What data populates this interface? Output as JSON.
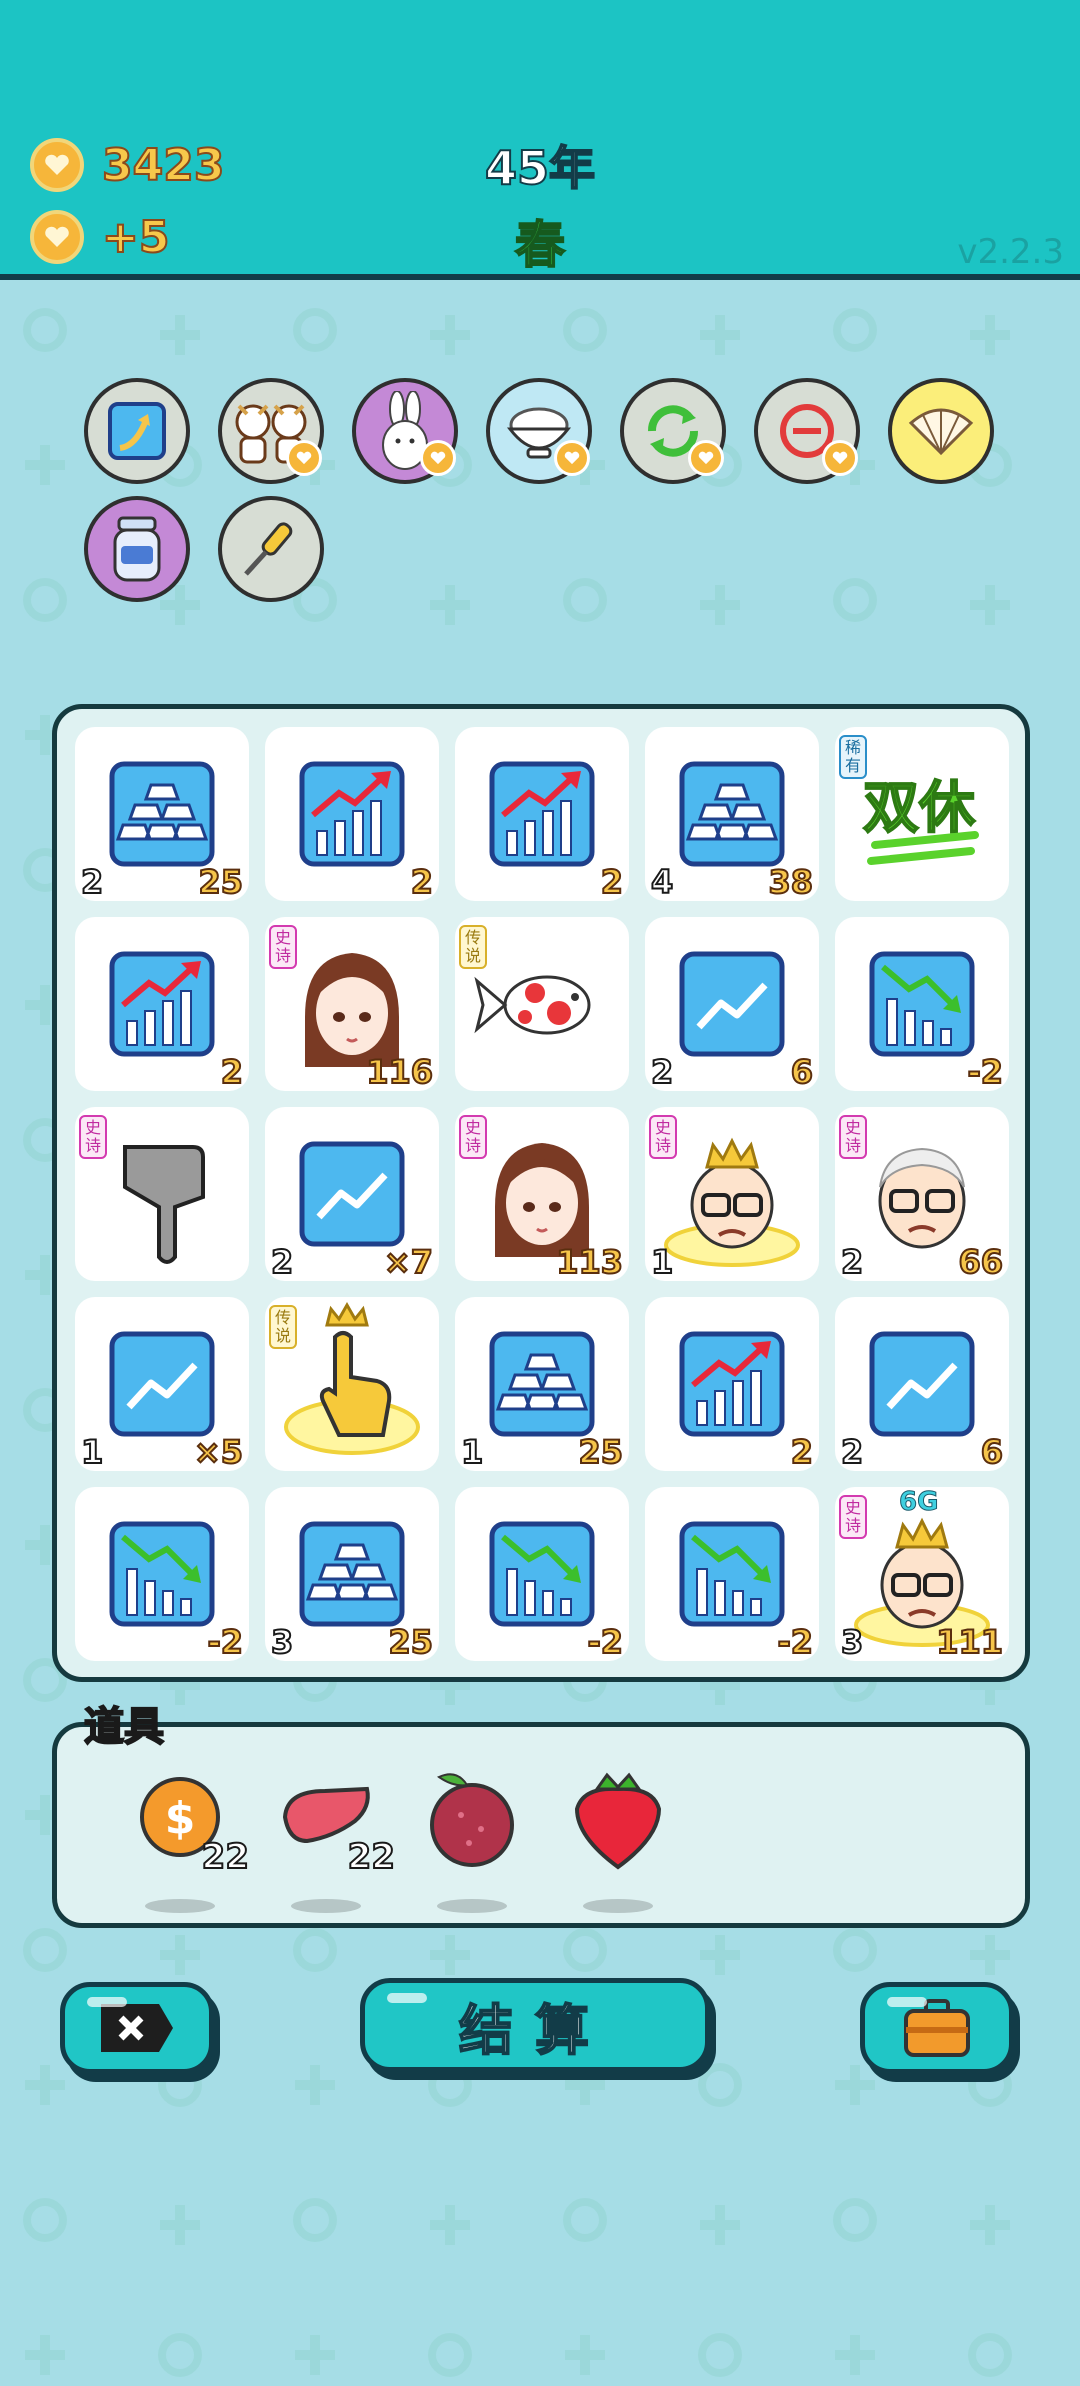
{
  "header": {
    "coins": "3423",
    "income": "+5",
    "year": "45年",
    "season": "春",
    "version": "v2.2.3",
    "coin_icon": "coin-heart-icon"
  },
  "top_icons": [
    {
      "name": "arrow-upgrade-icon",
      "bg": "#d7ddd4"
    },
    {
      "name": "cow-girls-icon",
      "bg": "#d7ddd4"
    },
    {
      "name": "rabbit-icon",
      "bg": "#c489d6"
    },
    {
      "name": "rice-bowl-icon",
      "bg": "#bfe8f4"
    },
    {
      "name": "refresh-icon",
      "bg": "#d7ddd4"
    },
    {
      "name": "minus-remove-icon",
      "bg": "#d7ddd4"
    },
    {
      "name": "shell-icon",
      "bg": "#fbee7a"
    },
    {
      "name": "jar-icon",
      "bg": "#c489d6"
    },
    {
      "name": "screwdriver-icon",
      "bg": "#d7ddd4"
    }
  ],
  "board": {
    "rows": [
      [
        {
          "icon": "gold-bars-icon",
          "left": "2",
          "right": "25",
          "tag": ""
        },
        {
          "icon": "chart-up-icon",
          "left": "",
          "right": "2",
          "tag": ""
        },
        {
          "icon": "chart-up-icon",
          "left": "",
          "right": "2",
          "tag": ""
        },
        {
          "icon": "gold-bars-icon",
          "left": "4",
          "right": "38",
          "tag": ""
        },
        {
          "icon": "double-rest-text-icon",
          "left": "",
          "right": "",
          "tag": "稀有",
          "text": "双休"
        }
      ],
      [
        {
          "icon": "chart-up-icon",
          "left": "",
          "right": "2",
          "tag": ""
        },
        {
          "icon": "girl-portrait-icon",
          "left": "",
          "right": "116",
          "tag": "史诗"
        },
        {
          "icon": "koi-fish-icon",
          "left": "",
          "right": "",
          "tag": "传说"
        },
        {
          "icon": "trend-line-icon",
          "left": "2",
          "right": "6",
          "tag": ""
        },
        {
          "icon": "chart-down-icon",
          "left": "",
          "right": "-2",
          "tag": ""
        }
      ],
      [
        {
          "icon": "pointing-hand-icon",
          "left": "",
          "right": "",
          "tag": "史诗"
        },
        {
          "icon": "trend-line-icon",
          "left": "2",
          "right": "×7",
          "tag": ""
        },
        {
          "icon": "girl-portrait-icon",
          "left": "",
          "right": "113",
          "tag": "史诗"
        },
        {
          "icon": "crowned-old-man-icon",
          "left": "1",
          "right": "",
          "tag": "史诗"
        },
        {
          "icon": "old-man-icon",
          "left": "2",
          "right": "66",
          "tag": "史诗"
        }
      ],
      [
        {
          "icon": "trend-line-icon",
          "left": "1",
          "right": "×5",
          "tag": ""
        },
        {
          "icon": "golden-hand-icon",
          "left": "",
          "right": "",
          "tag": "传说"
        },
        {
          "icon": "gold-bars-icon",
          "left": "1",
          "right": "25",
          "tag": ""
        },
        {
          "icon": "chart-up-icon",
          "left": "",
          "right": "2",
          "tag": ""
        },
        {
          "icon": "trend-line-icon",
          "left": "2",
          "right": "6",
          "tag": ""
        }
      ],
      [
        {
          "icon": "chart-down-icon",
          "left": "",
          "right": "-2",
          "tag": ""
        },
        {
          "icon": "gold-bars-icon",
          "left": "3",
          "right": "25",
          "tag": ""
        },
        {
          "icon": "chart-down-icon",
          "left": "",
          "right": "-2",
          "tag": ""
        },
        {
          "icon": "chart-down-icon",
          "left": "",
          "right": "-2",
          "tag": ""
        },
        {
          "icon": "crowned-old-man-6g-icon",
          "left": "3",
          "right": "111",
          "tag": "史诗",
          "crown_text": "6G"
        }
      ]
    ]
  },
  "tools": {
    "label": "道具",
    "items": [
      {
        "icon": "dollar-coin-icon",
        "count": "22"
      },
      {
        "icon": "liver-icon",
        "count": "22"
      },
      {
        "icon": "lychee-icon",
        "count": ""
      },
      {
        "icon": "strawberry-icon",
        "count": ""
      }
    ]
  },
  "buttons": {
    "close_icon": "close-x-icon",
    "settle_label": "结算",
    "bag_icon": "briefcase-icon"
  }
}
